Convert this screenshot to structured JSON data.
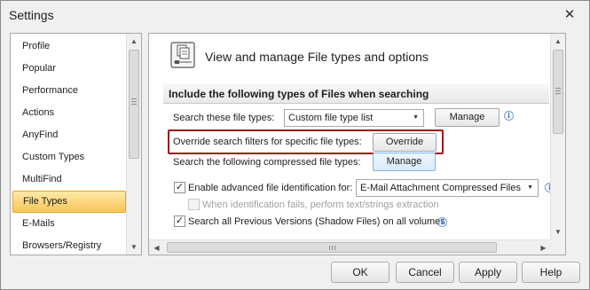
{
  "window": {
    "title": "Settings",
    "close_symbol": "✕"
  },
  "sidebar": {
    "items": [
      {
        "label": "Profile"
      },
      {
        "label": "Popular"
      },
      {
        "label": "Performance"
      },
      {
        "label": "Actions"
      },
      {
        "label": "AnyFind"
      },
      {
        "label": "Custom Types"
      },
      {
        "label": "MultiFind"
      },
      {
        "label": "File Types",
        "selected": true
      },
      {
        "label": "E-Mails"
      },
      {
        "label": "Browsers/Registry"
      }
    ],
    "selected_index": 7
  },
  "main": {
    "header_title": "View and manage File types and options",
    "section_title": "Include the following types of Files when searching",
    "file_types_label": "Search these file types:",
    "file_types_value": "Custom file type list",
    "manage_label": "Manage",
    "override_label": "Override search filters for specific file types:",
    "override_button": "Override",
    "compressed_label": "Search the following compressed file types:",
    "compressed_manage": "Manage",
    "advanced_id_label": "Enable advanced file identification for:",
    "advanced_id_checked": true,
    "advanced_id_value": "E-Mail Attachment Compressed Files",
    "fallback_label": "When identification fails, perform text/strings extraction",
    "fallback_checked": false,
    "shadow_label": "Search all Previous Versions (Shadow Files) on all volumes",
    "shadow_checked": true
  },
  "footer": {
    "ok": "OK",
    "cancel": "Cancel",
    "apply": "Apply",
    "help": "Help"
  },
  "colors": {
    "selected_item_bg": "#f9c55a",
    "highlight_border": "#9b1b1b",
    "info_icon": "#3a77c8"
  },
  "icons": {
    "header": "file-types-icon",
    "info": "info-icon",
    "check": "✓"
  }
}
